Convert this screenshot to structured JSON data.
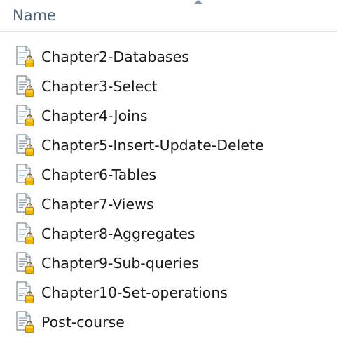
{
  "header": {
    "column_label": "Name",
    "sort_icon": "sort-ascending-icon"
  },
  "files": [
    {
      "name": "Chapter2-Databases",
      "icon": "locked-document-icon"
    },
    {
      "name": "Chapter3-Select",
      "icon": "locked-document-icon"
    },
    {
      "name": "Chapter4-Joins",
      "icon": "locked-document-icon"
    },
    {
      "name": "Chapter5-Insert-Update-Delete",
      "icon": "locked-document-icon"
    },
    {
      "name": "Chapter6-Tables",
      "icon": "locked-document-icon"
    },
    {
      "name": "Chapter7-Views",
      "icon": "locked-document-icon"
    },
    {
      "name": "Chapter8-Aggregates",
      "icon": "locked-document-icon"
    },
    {
      "name": "Chapter9-Sub-queries",
      "icon": "locked-document-icon"
    },
    {
      "name": "Chapter10-Set-operations",
      "icon": "locked-document-icon"
    },
    {
      "name": "Post-course",
      "icon": "locked-document-icon"
    }
  ],
  "colors": {
    "header_text": "#4c607a",
    "divider": "#e5e5e5",
    "lock_gold": "#f2b600"
  }
}
